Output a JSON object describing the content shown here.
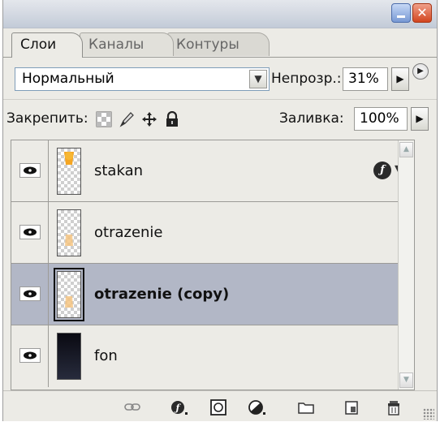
{
  "tabs": {
    "layers": "Слои",
    "channels": "Каналы",
    "paths": "Контуры"
  },
  "blend": {
    "mode": "Нормальный",
    "opacity_label": "Непрозр.:",
    "opacity_value": "31%"
  },
  "lock": {
    "label": "Закрепить:",
    "fill_label": "Заливка:",
    "fill_value": "100%"
  },
  "layers": [
    {
      "name": "stakan",
      "thumb": "orange-glass-on-transparent",
      "has_effects": true
    },
    {
      "name": "otrazenie",
      "thumb": "faded-orange-on-transparent",
      "has_effects": false
    },
    {
      "name": "otrazenie (copy)",
      "thumb": "faded-orange-on-transparent",
      "has_effects": false,
      "selected": true
    },
    {
      "name": "fon",
      "thumb": "dark-gradient",
      "has_effects": false
    }
  ],
  "bottom_toolbar": [
    "link-icon",
    "layer-style-icon",
    "mask-icon",
    "adjustment-icon",
    "folder-icon",
    "new-layer-icon",
    "trash-icon"
  ],
  "colors": {
    "selected_row": "#b2b7c6",
    "panel_bg": "#ecebe6",
    "accent_orange": "#f5a623"
  }
}
